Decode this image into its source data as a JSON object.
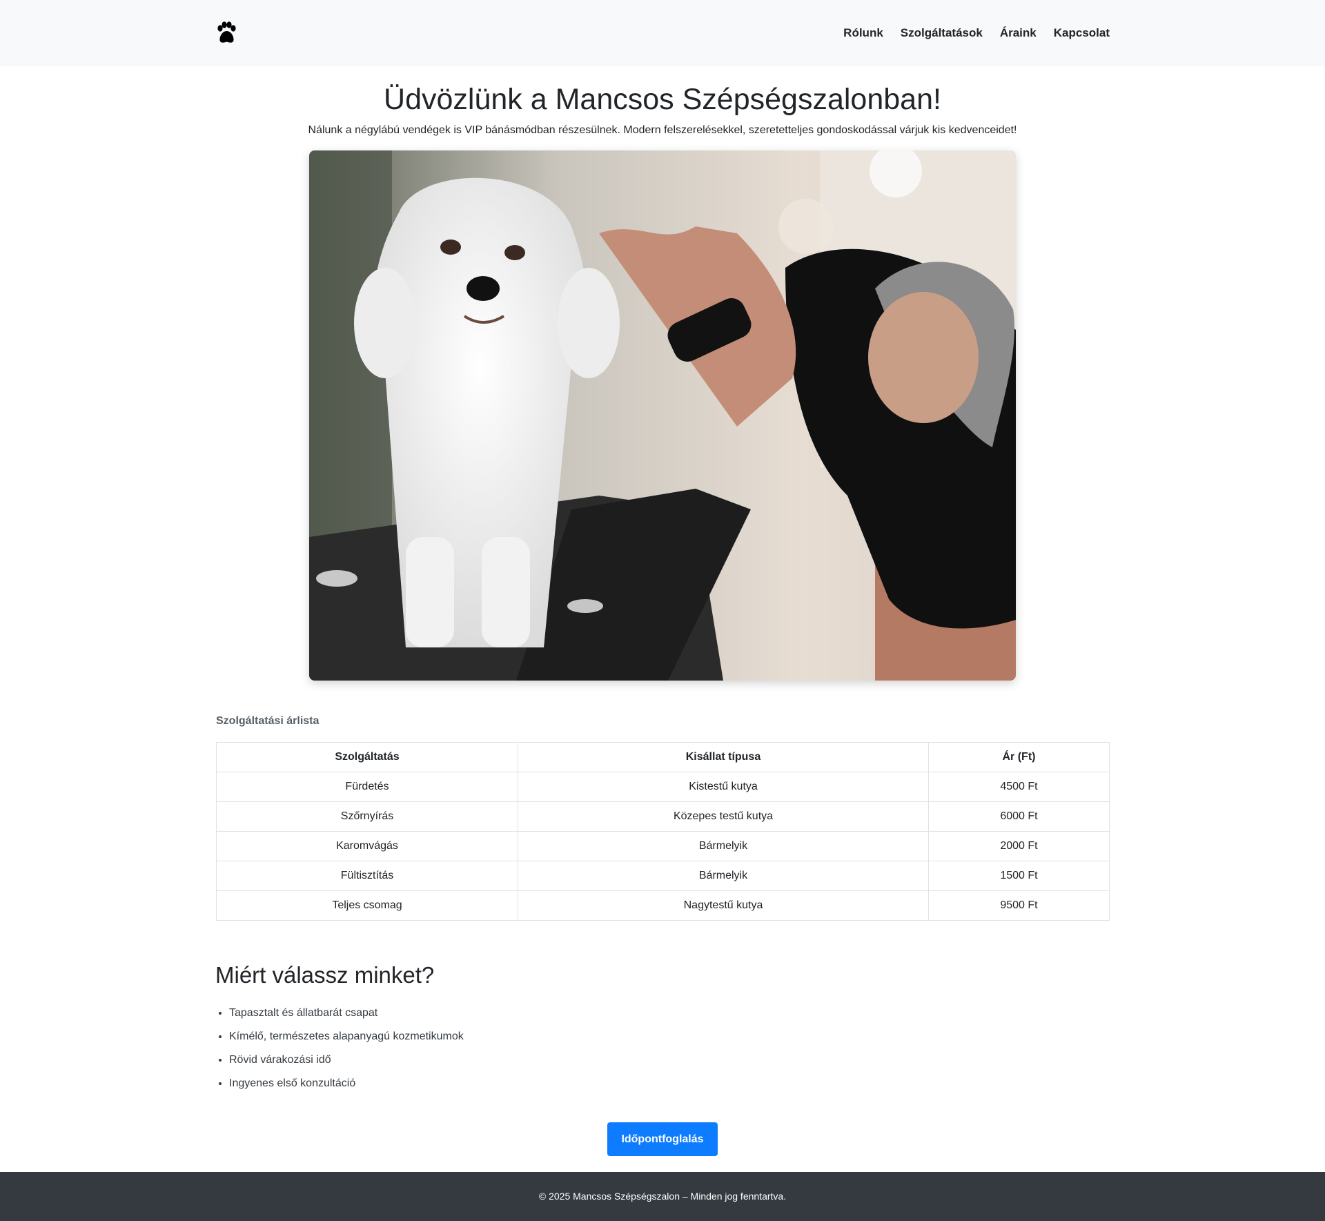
{
  "navbar": {
    "brand_icon": "paw-icon",
    "links": [
      {
        "label": "Rólunk"
      },
      {
        "label": "Szolgáltatások"
      },
      {
        "label": "Áraink"
      },
      {
        "label": "Kapcsolat"
      }
    ]
  },
  "hero": {
    "title": "Üdvözlünk a Mancsos Szépségszalonban!",
    "subtitle": "Nálunk a négylábú vendégek is VIP bánásmódban részesülnek. Modern felszerelésekkel, szeretetteljes gondoskodással várjuk kis kedvenceidet!",
    "image": "photo of a white fluffy dog being groomed with clippers by a groomer on a grooming table"
  },
  "prices": {
    "caption": "Szolgáltatási árlista",
    "headers": [
      "Szolgáltatás",
      "Kisállat típusa",
      "Ár (Ft)"
    ],
    "rows": [
      [
        "Fürdetés",
        "Kistestű kutya",
        "4500 Ft"
      ],
      [
        "Szőrnyírás",
        "Közepes testű kutya",
        "6000 Ft"
      ],
      [
        "Karomvágás",
        "Bármelyik",
        "2000 Ft"
      ],
      [
        "Fültisztítás",
        "Bármelyik",
        "1500 Ft"
      ],
      [
        "Teljes csomag",
        "Nagytestű kutya",
        "9500 Ft"
      ]
    ]
  },
  "why": {
    "title": "Miért válassz minket?",
    "items": [
      "Tapasztalt és állatbarát csapat",
      "Kímélő, természetes alapanyagú kozmetikumok",
      "Rövid várakozási idő",
      "Ingyenes első konzultáció"
    ]
  },
  "cta": {
    "label": "Időpontfoglalás"
  },
  "footer": {
    "text": "© 2025 Mancsos Szépségszalon – Minden jog fenntartva."
  },
  "colors": {
    "navbar_bg": "#f8f9fa",
    "primary": "#0d7cff",
    "footer_bg": "#343a40"
  }
}
